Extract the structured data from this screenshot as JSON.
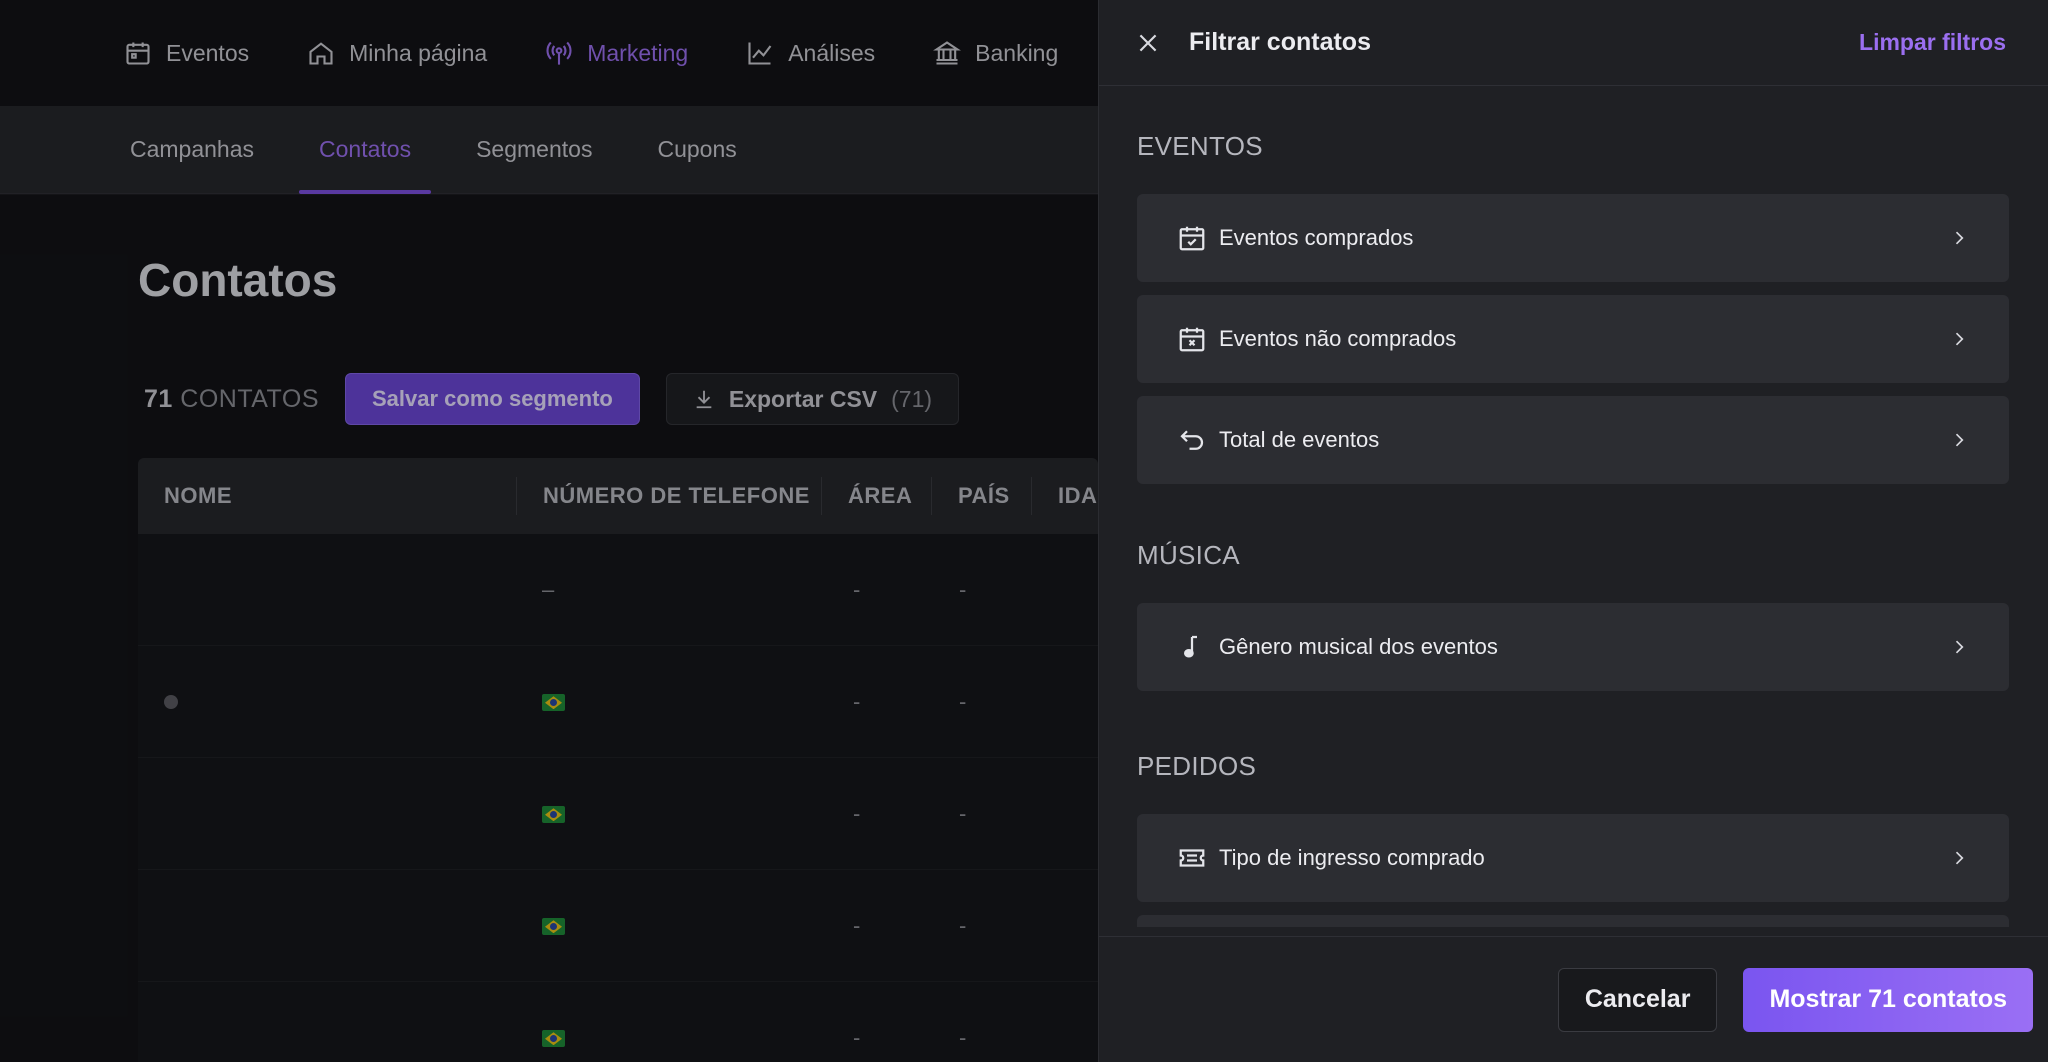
{
  "topnav": {
    "items": [
      {
        "label": "Eventos",
        "icon": "calendar-icon"
      },
      {
        "label": "Minha página",
        "icon": "home-icon"
      },
      {
        "label": "Marketing",
        "icon": "broadcast-icon",
        "active": true
      },
      {
        "label": "Análises",
        "icon": "chart-line-icon"
      },
      {
        "label": "Banking",
        "icon": "bank-icon"
      }
    ]
  },
  "subnav": {
    "tabs": [
      "Campanhas",
      "Contatos",
      "Segmentos",
      "Cupons"
    ],
    "active": "Contatos"
  },
  "page": {
    "title": "Contatos",
    "count_number": "71",
    "count_label": "CONTATOS",
    "save_segment_label": "Salvar como segmento",
    "export_label": "Exportar CSV",
    "export_count": "(71)"
  },
  "table": {
    "headers": [
      "NOME",
      "NÚMERO DE TELEFONE",
      "ÁREA",
      "PAÍS",
      "IDA"
    ],
    "rows": [
      {
        "phone": "–",
        "area": "-",
        "pais": "-",
        "flag": false
      },
      {
        "phone": "",
        "area": "-",
        "pais": "-",
        "flag": true
      },
      {
        "phone": "",
        "area": "-",
        "pais": "-",
        "flag": true
      },
      {
        "phone": "",
        "area": "-",
        "pais": "-",
        "flag": true
      },
      {
        "phone": "",
        "area": "-",
        "pais": "-",
        "flag": true
      }
    ]
  },
  "drawer": {
    "title": "Filtrar contatos",
    "clear_label": "Limpar filtros",
    "sections": [
      {
        "title": "EVENTOS",
        "filters": [
          {
            "label": "Eventos comprados",
            "icon": "calendar-check-icon"
          },
          {
            "label": "Eventos não comprados",
            "icon": "calendar-x-icon"
          },
          {
            "label": "Total de eventos",
            "icon": "undo-arrow-icon"
          }
        ]
      },
      {
        "title": "MÚSICA",
        "filters": [
          {
            "label": "Gênero musical dos eventos",
            "icon": "music-note-icon"
          }
        ]
      },
      {
        "title": "PEDIDOS",
        "filters": [
          {
            "label": "Tipo de ingresso comprado",
            "icon": "ticket-icon"
          }
        ]
      }
    ],
    "cancel_label": "Cancelar",
    "show_label": "Mostrar 71 contatos"
  },
  "colors": {
    "accent": "#9b6ff0",
    "button_primary": "#7a55f0",
    "drawer_bg": "#1f2024",
    "filter_bg": "#2c2d32"
  }
}
